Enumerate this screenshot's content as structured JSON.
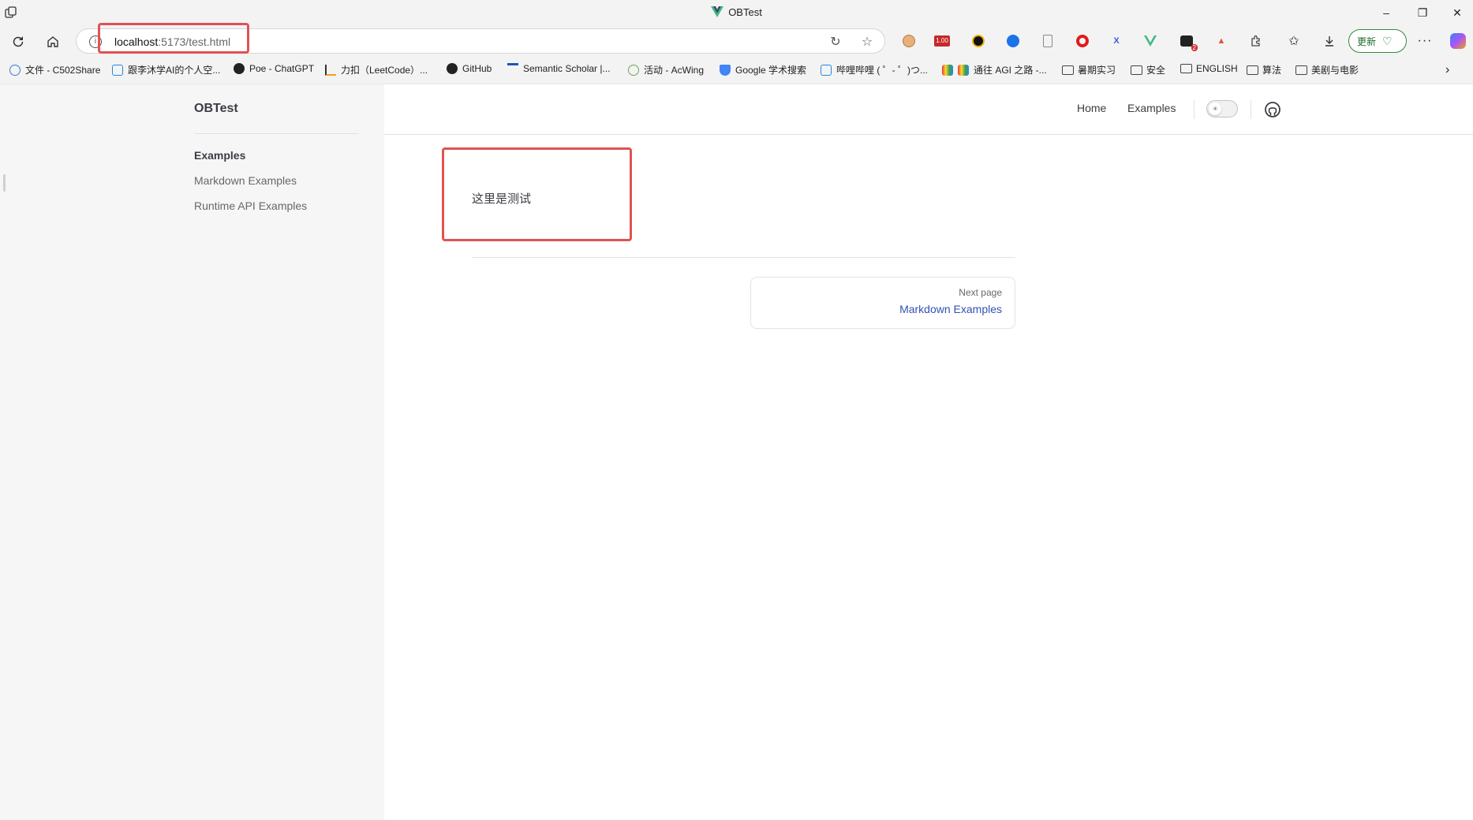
{
  "browser": {
    "window_title": "OBTest",
    "url_host": "localhost",
    "url_rest": ":5173/test.html",
    "update_label": "更新",
    "colors": {
      "highlight": "#e05252",
      "update_border": "#2e8b3a",
      "chrome_bg": "#f3f3f3"
    },
    "extension_badges": {
      "counter": "1.00",
      "mail_count": "2"
    }
  },
  "bookmarks": [
    {
      "label": "文件 - C502Share",
      "icon": "globe-icon"
    },
    {
      "label": "跟李沐学AI的个人空...",
      "icon": "bilibili-icon"
    },
    {
      "label": "Poe - ChatGPT",
      "icon": "poe-icon"
    },
    {
      "label": "力扣（LeetCode）...",
      "icon": "leetcode-icon"
    },
    {
      "label": "GitHub",
      "icon": "github-icon"
    },
    {
      "label": "Semantic Scholar |...",
      "icon": "semantic-scholar-icon"
    },
    {
      "label": "活动 - AcWing",
      "icon": "acwing-icon"
    },
    {
      "label": "Google 学术搜索",
      "icon": "scholar-icon"
    },
    {
      "label": "哔哩哔哩 ( ゜- ゜)つ...",
      "icon": "bilibili-icon"
    },
    {
      "label": "通往 AGI 之路 -...",
      "icon": "rainbow-icon"
    },
    {
      "label": "暑期实习",
      "icon": "folder-icon"
    },
    {
      "label": "安全",
      "icon": "folder-icon"
    },
    {
      "label": "ENGLISH",
      "icon": "folder-icon"
    },
    {
      "label": "算法",
      "icon": "folder-icon"
    },
    {
      "label": "美剧与电影",
      "icon": "folder-icon"
    }
  ],
  "site": {
    "title": "OBTest",
    "sidebar": {
      "section": "Examples",
      "links": [
        "Markdown Examples",
        "Runtime API Examples"
      ]
    },
    "nav": {
      "home": "Home",
      "examples": "Examples"
    },
    "content": {
      "text": "这里是测试"
    },
    "pager": {
      "desc": "Next page",
      "title": "Markdown Examples"
    }
  }
}
